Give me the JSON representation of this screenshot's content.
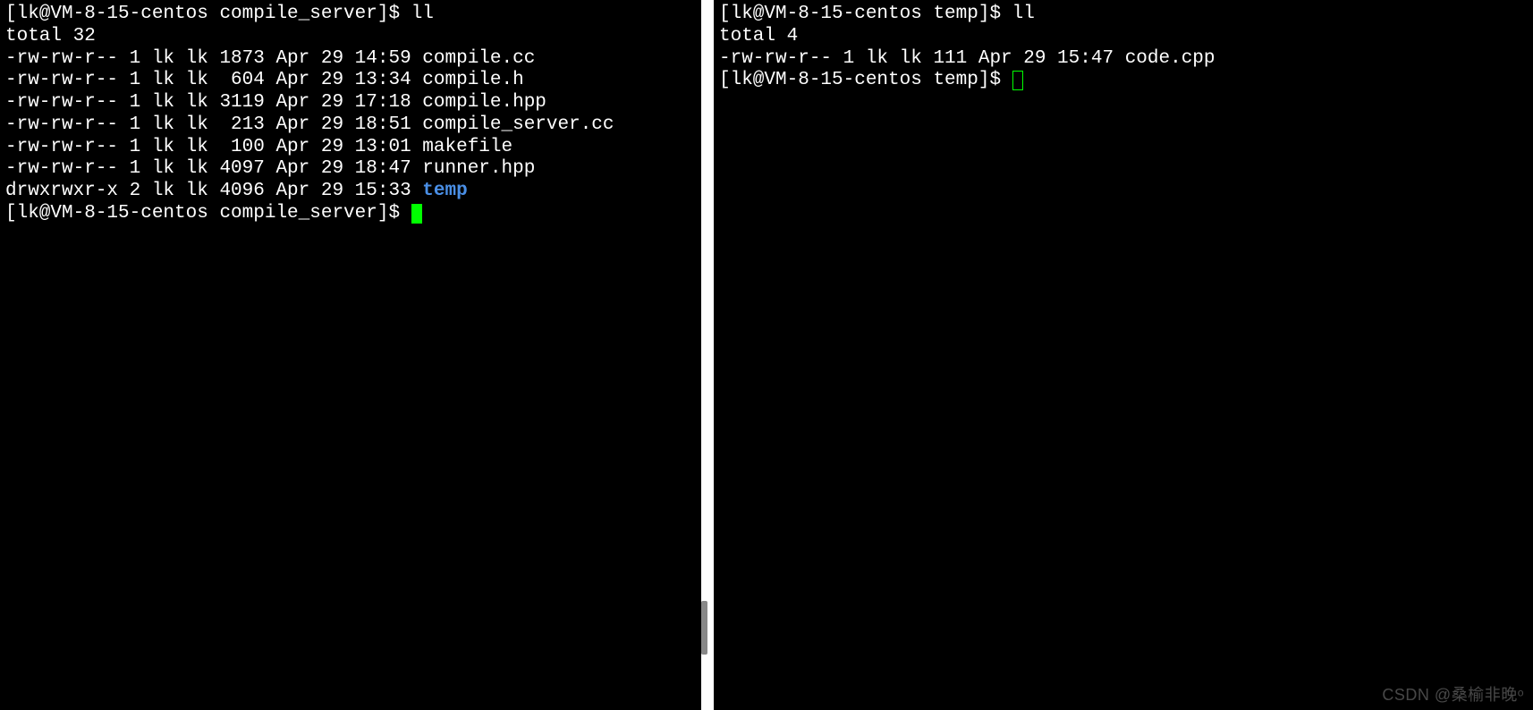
{
  "left": {
    "prompt1": {
      "prefix": "[lk@VM-8-15-centos compile_server]$ ",
      "command": "ll"
    },
    "total": "total 32",
    "rows": [
      {
        "perm": "-rw-rw-r--",
        "links": "1",
        "owner": "lk",
        "group": "lk",
        "size": "1873",
        "date": "Apr 29 14:59",
        "name": "compile.cc",
        "is_dir": false
      },
      {
        "perm": "-rw-rw-r--",
        "links": "1",
        "owner": "lk",
        "group": "lk",
        "size": " 604",
        "date": "Apr 29 13:34",
        "name": "compile.h",
        "is_dir": false
      },
      {
        "perm": "-rw-rw-r--",
        "links": "1",
        "owner": "lk",
        "group": "lk",
        "size": "3119",
        "date": "Apr 29 17:18",
        "name": "compile.hpp",
        "is_dir": false
      },
      {
        "perm": "-rw-rw-r--",
        "links": "1",
        "owner": "lk",
        "group": "lk",
        "size": " 213",
        "date": "Apr 29 18:51",
        "name": "compile_server.cc",
        "is_dir": false
      },
      {
        "perm": "-rw-rw-r--",
        "links": "1",
        "owner": "lk",
        "group": "lk",
        "size": " 100",
        "date": "Apr 29 13:01",
        "name": "makefile",
        "is_dir": false
      },
      {
        "perm": "-rw-rw-r--",
        "links": "1",
        "owner": "lk",
        "group": "lk",
        "size": "4097",
        "date": "Apr 29 18:47",
        "name": "runner.hpp",
        "is_dir": false
      },
      {
        "perm": "drwxrwxr-x",
        "links": "2",
        "owner": "lk",
        "group": "lk",
        "size": "4096",
        "date": "Apr 29 15:33",
        "name": "temp",
        "is_dir": true
      }
    ],
    "prompt2": "[lk@VM-8-15-centos compile_server]$ "
  },
  "right": {
    "prompt1": {
      "prefix": "[lk@VM-8-15-centos temp]$ ",
      "command": "ll"
    },
    "total": "total 4",
    "rows": [
      {
        "perm": "-rw-rw-r--",
        "links": "1",
        "owner": "lk",
        "group": "lk",
        "size": "111",
        "date": "Apr 29 15:47",
        "name": "code.cpp",
        "is_dir": false
      }
    ],
    "prompt2": "[lk@VM-8-15-centos temp]$ "
  },
  "watermark": "CSDN @桑榆非晚ᵒ"
}
